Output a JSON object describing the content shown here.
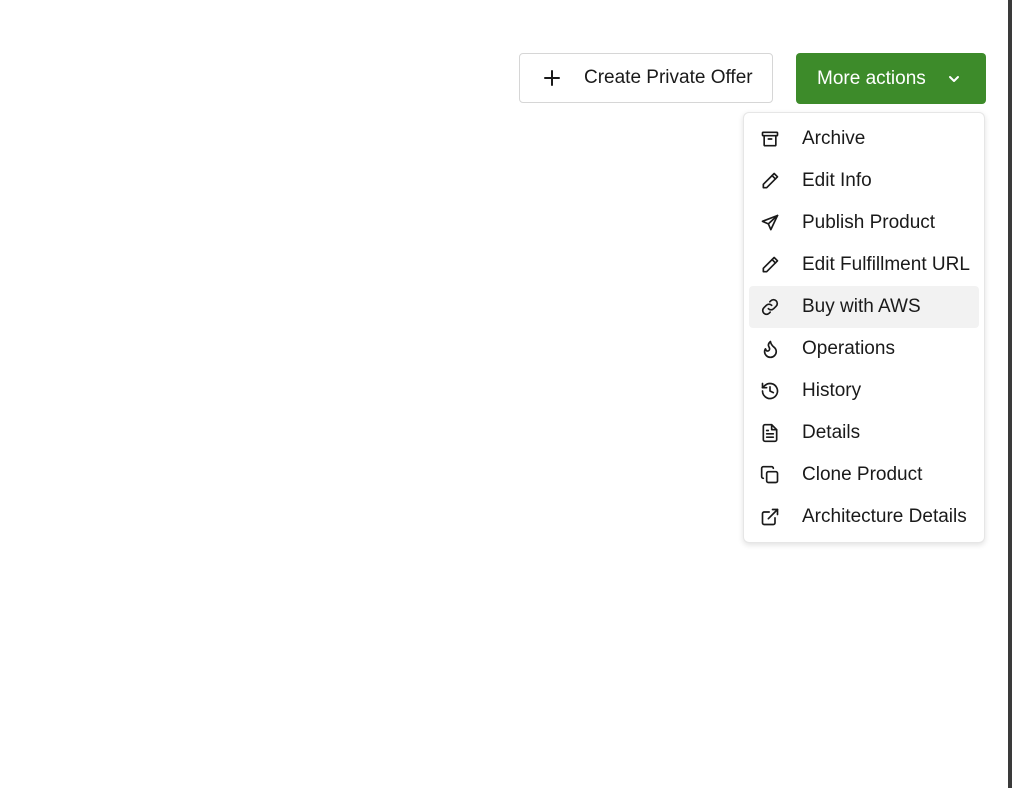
{
  "header": {
    "create_private_offer": {
      "label": "Create Private Offer",
      "icon": "plus-icon"
    },
    "more_actions": {
      "label": "More actions",
      "icon": "chevron-down-icon",
      "color": "#3d8b2a"
    }
  },
  "menu": {
    "hovered_item": "Buy with AWS",
    "items": [
      {
        "label": "Archive",
        "icon": "archive-icon"
      },
      {
        "label": "Edit Info",
        "icon": "pencil-icon"
      },
      {
        "label": "Publish Product",
        "icon": "send-icon"
      },
      {
        "label": "Edit Fulfillment URL",
        "icon": "pencil-icon"
      },
      {
        "label": "Buy with AWS",
        "icon": "link-icon"
      },
      {
        "label": "Operations",
        "icon": "flame-icon"
      },
      {
        "label": "History",
        "icon": "history-icon"
      },
      {
        "label": "Details",
        "icon": "file-text-icon"
      },
      {
        "label": "Clone Product",
        "icon": "copy-icon"
      },
      {
        "label": "Architecture Details",
        "icon": "external-link-icon"
      }
    ]
  }
}
